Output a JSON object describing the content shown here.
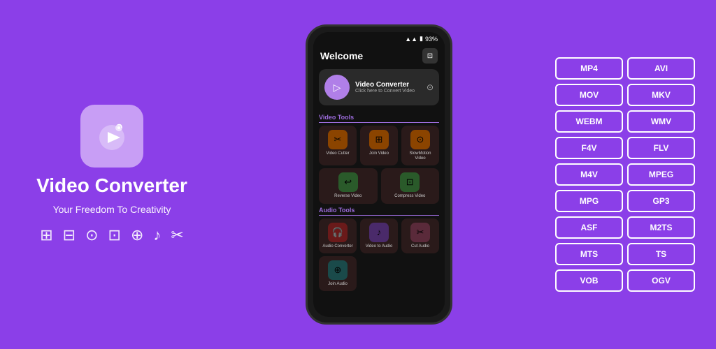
{
  "left": {
    "app_title": "Video Converter",
    "app_subtitle": "Your Freedom To Creativity"
  },
  "phone": {
    "status": "93%",
    "header_title": "Welcome",
    "vc_card": {
      "title": "Video Converter",
      "subtitle": "Click here to Convert Video"
    },
    "video_tools_label": "Video Tools",
    "video_tools": [
      {
        "label": "Video Cutter",
        "icon": "✂",
        "color": "orange"
      },
      {
        "label": "Join Video",
        "icon": "⊕",
        "color": "orange"
      },
      {
        "label": "SlowMotion Video",
        "icon": "⊙",
        "color": "orange"
      },
      {
        "label": "Reverse Video",
        "icon": "↩",
        "color": "green"
      },
      {
        "label": "Compress Video",
        "icon": "⊞",
        "color": "green"
      }
    ],
    "audio_tools_label": "Audio Tools",
    "audio_tools": [
      {
        "label": "Audio Converter",
        "icon": "🎧",
        "color": "red"
      },
      {
        "label": "Video to Audio",
        "icon": "♪",
        "color": "purple"
      },
      {
        "label": "Cut Audio",
        "icon": "✂",
        "color": "maroon"
      },
      {
        "label": "Join Audio",
        "icon": "⊕",
        "color": "teal"
      }
    ]
  },
  "formats": [
    "MP4",
    "AVI",
    "MOV",
    "MKV",
    "WEBM",
    "WMV",
    "F4V",
    "FLV",
    "M4V",
    "MPEG",
    "MPG",
    "GP3",
    "ASF",
    "M2TS",
    "MTS",
    "TS",
    "VOB",
    "OGV"
  ],
  "icons": {
    "video_cutter": "✂",
    "join_video": "⊕",
    "slow_motion": "⊙",
    "reverse": "↩",
    "compress": "⊞",
    "audio_converter": "🎧",
    "video_to_audio": "♪",
    "cut_audio": "✂",
    "join_audio": "⊕"
  }
}
